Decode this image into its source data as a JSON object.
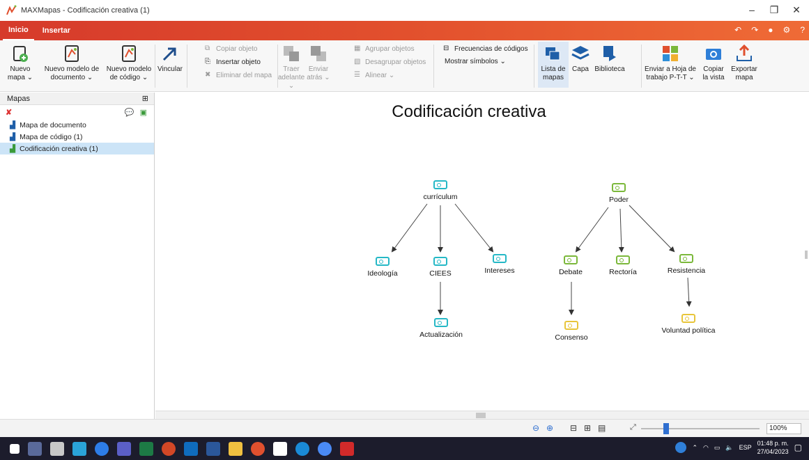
{
  "window": {
    "title": "MAXMapas - Codificación creativa (1)",
    "minimize": "–",
    "maximize": "❐",
    "close": "✕"
  },
  "tabs": [
    {
      "label": "Inicio"
    },
    {
      "label": "Insertar"
    }
  ],
  "ribbon": {
    "nuevo_mapa": "Nuevo mapa ⌄",
    "nuevo_modelo_documento": "Nuevo modelo de documento ⌄",
    "nuevo_modelo_codigo": "Nuevo modelo de código ⌄",
    "vincular": "Vincular",
    "copiar_objeto": "Copiar objeto",
    "insertar_objeto": "Insertar objeto",
    "eliminar_del_mapa": "Eliminar del mapa",
    "traer_adelante": "Traer adelante ⌄",
    "enviar_atras": "Enviar atrás ⌄",
    "agrupar_objetos": "Agrupar objetos",
    "desagrupar_objetos": "Desagrupar objetos",
    "alinear": "Alinear ⌄",
    "frecuencias_codigos": "Frecuencias de códigos",
    "mostrar_simbolos": "Mostrar símbolos ⌄",
    "lista_de_mapas": "Lista de mapas",
    "capa": "Capa",
    "biblioteca": "Biblioteca",
    "enviar_hoja": "Enviar a Hoja de trabajo P-T-T ⌄",
    "copiar_vista": "Copiar la vista",
    "exportar_mapa": "Exportar mapa"
  },
  "sidebar": {
    "title": "Mapas",
    "items": [
      {
        "label": "Mapa de documento"
      },
      {
        "label": "Mapa de código (1)"
      },
      {
        "label": "Codificación creativa (1)"
      }
    ]
  },
  "map": {
    "title": "Codificación creativa",
    "nodes": {
      "curriculum": "currículum",
      "ideologia": "Ideología",
      "ciees": "CIEES",
      "intereses": "Intereses",
      "actualizacion": "Actualización",
      "poder": "Poder",
      "debate": "Debate",
      "rectoria": "Rectoría",
      "resistencia": "Resistencia",
      "consenso": "Consenso",
      "voluntad": "Voluntad política"
    }
  },
  "statusbar": {
    "zoom": "100%"
  },
  "taskbar": {
    "lang": "ESP",
    "time": "01:48 p. m.",
    "date": "27/04/2023"
  },
  "colors": {
    "teal": "#25b8c6",
    "green": "#7bb83a",
    "yellow": "#e8c53a",
    "ribbon_red": "#d63a2b"
  }
}
